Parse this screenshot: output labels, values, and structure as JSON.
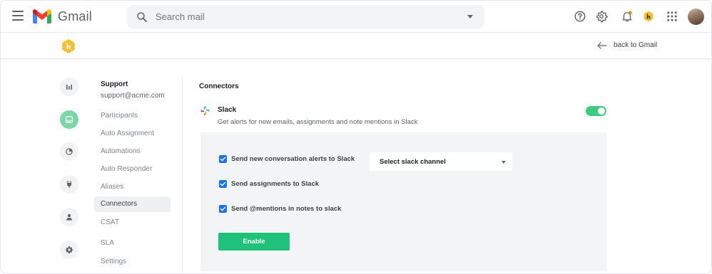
{
  "header": {
    "app_name": "Gmail",
    "search_placeholder": "Search mail"
  },
  "subheader": {
    "back_label": "back to Gmail"
  },
  "sidebar": {
    "inbox_name": "Support",
    "inbox_email": "support@acme.com",
    "items": [
      {
        "label": "Participants"
      },
      {
        "label": "Auto Assignment"
      },
      {
        "label": "Automations"
      },
      {
        "label": "Auto Responder"
      },
      {
        "label": "Aliases"
      },
      {
        "label": "Connectors"
      },
      {
        "label": "CSAT"
      },
      {
        "label": "SLA"
      },
      {
        "label": "Settings"
      }
    ],
    "active_item": "Connectors"
  },
  "rail": {
    "icons": [
      "bar-chart-icon",
      "inbox-icon",
      "pie-chart-icon",
      "plug-icon",
      "user-icon",
      "gear-icon"
    ],
    "active_icon": "inbox-icon"
  },
  "main": {
    "section_title": "Connectors",
    "connector": {
      "name": "Slack",
      "description": "Get alerts for new emails, assignments and note mentions in Slack",
      "enabled": true
    },
    "options": [
      {
        "label": "Send new conversation alerts to Slack",
        "checked": true
      },
      {
        "label": "Send assignments to Slack",
        "checked": true
      },
      {
        "label": "Send @mentions in notes to slack",
        "checked": true
      }
    ],
    "channel_select": "Select slack channel",
    "enable_label": "Enable"
  },
  "colors": {
    "accent_green": "#1fc17b",
    "toggle_green": "#3ccc7b",
    "checkbox_blue": "#1a73e8",
    "rail_active": "#7dd6a8",
    "notification_dot": "#ea8600",
    "hiver_yellow": "#f5c033"
  }
}
